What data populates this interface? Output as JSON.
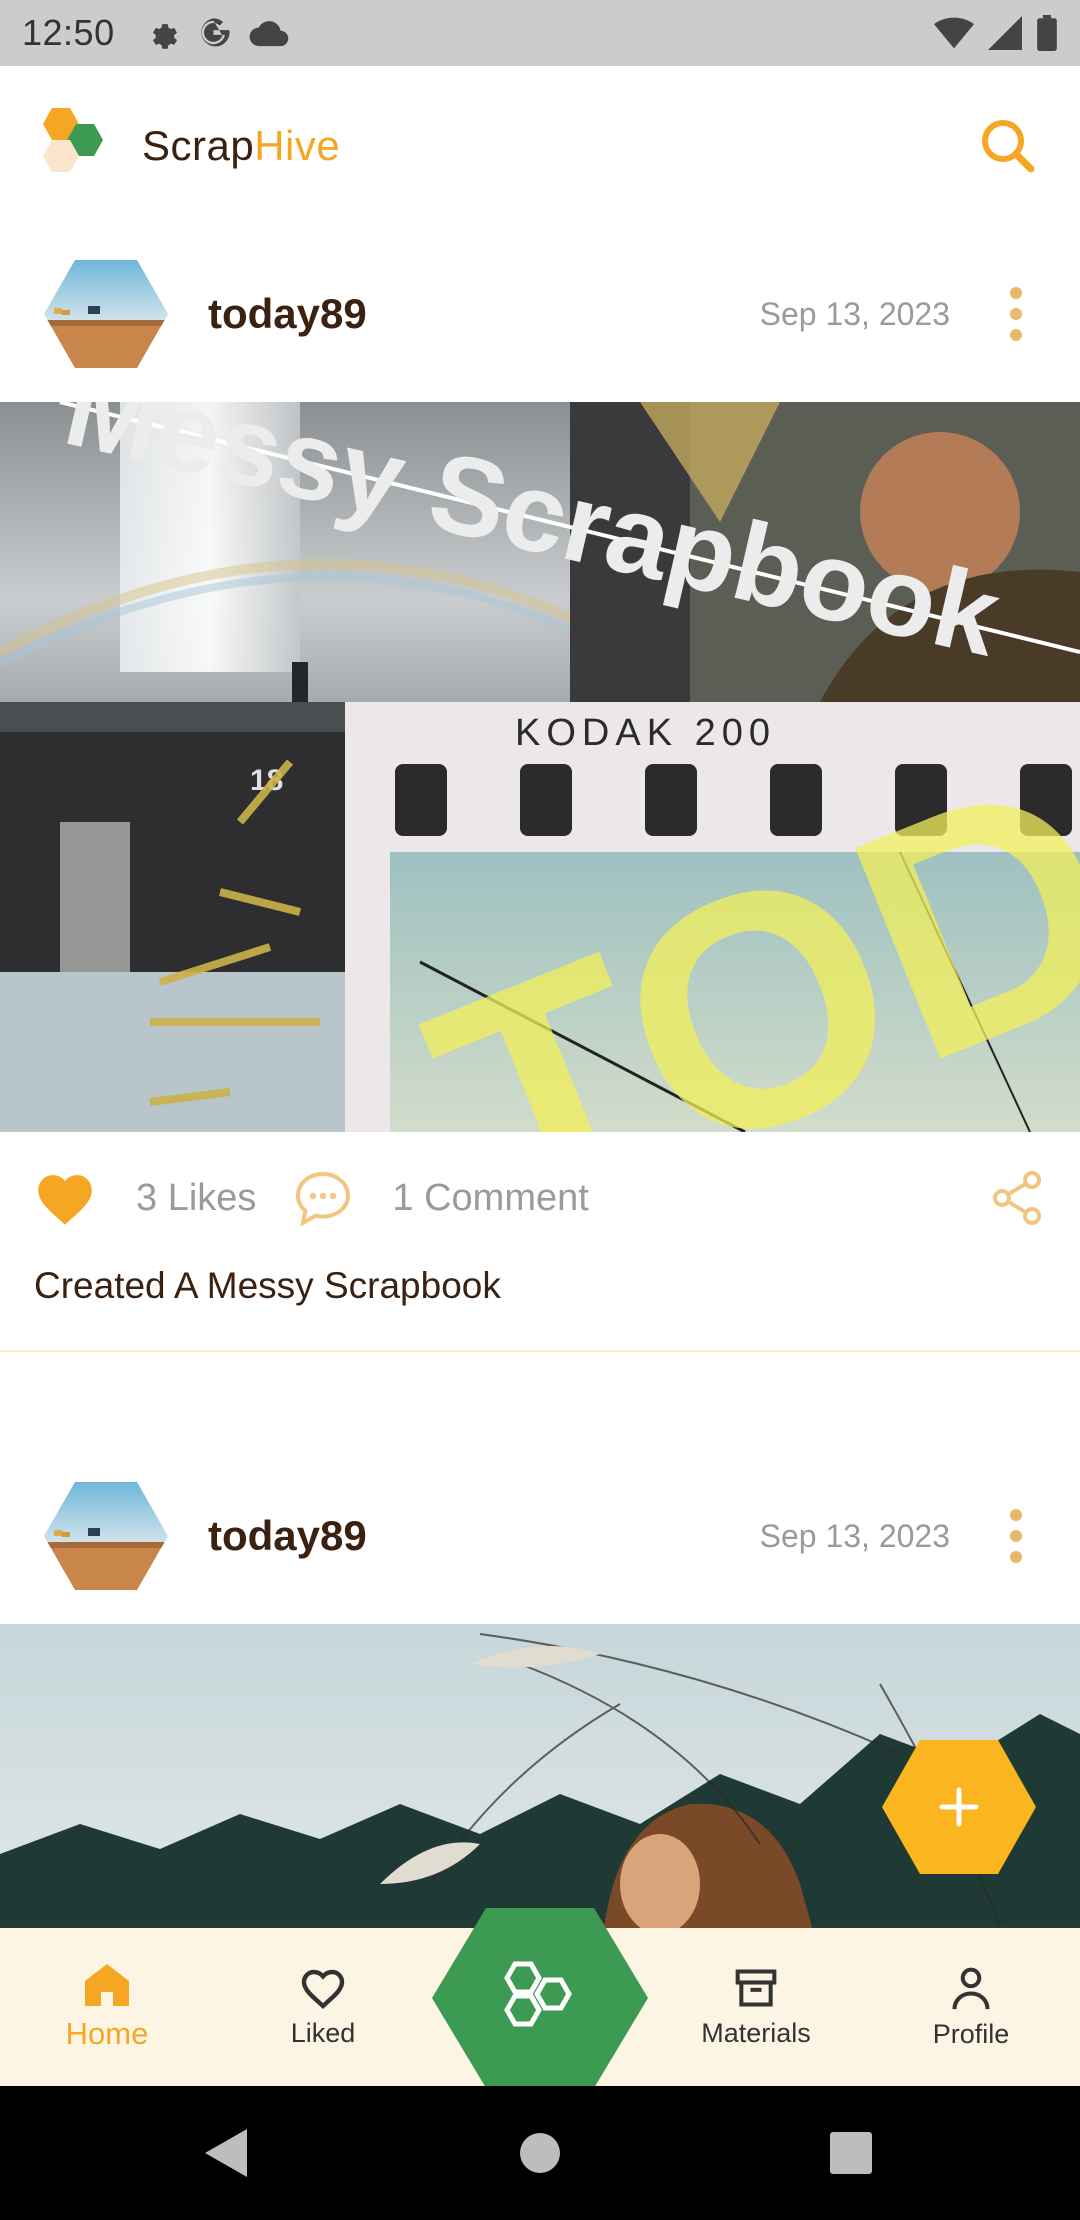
{
  "status_bar": {
    "time": "12:50",
    "left_icons": [
      "settings-icon",
      "google-icon",
      "cloud-icon"
    ],
    "right_icons": [
      "wifi-icon",
      "signal-icon",
      "battery-icon"
    ]
  },
  "header": {
    "brand_part1": "Scrap",
    "brand_part2": "Hive",
    "search_icon": "search-icon"
  },
  "colors": {
    "accent": "#f5a623",
    "brand_dark": "#3b2210",
    "green": "#3d9a52",
    "nav_bg": "#fdf5e4",
    "muted": "#9a9a9a"
  },
  "posts": [
    {
      "username": "today89",
      "date": "Sep 13, 2023",
      "likes_label": "3 Likes",
      "comments_label": "1 Comment",
      "caption": "Created A Messy Scrapbook",
      "image_text_1": "Messy Scrapbook",
      "image_text_2": "KODAK 200",
      "image_text_3": "18",
      "image_text_4": "TODA"
    },
    {
      "username": "today89",
      "date": "Sep 13, 2023"
    }
  ],
  "bottom_nav": [
    {
      "label": "Home",
      "icon": "home-icon",
      "active": true
    },
    {
      "label": "Liked",
      "icon": "heart-icon",
      "active": false
    },
    {
      "label": "",
      "icon": "hexagons-icon",
      "active": false
    },
    {
      "label": "Materials",
      "icon": "archive-icon",
      "active": false
    },
    {
      "label": "Profile",
      "icon": "person-icon",
      "active": false
    }
  ],
  "fab": {
    "icon": "plus-icon"
  }
}
